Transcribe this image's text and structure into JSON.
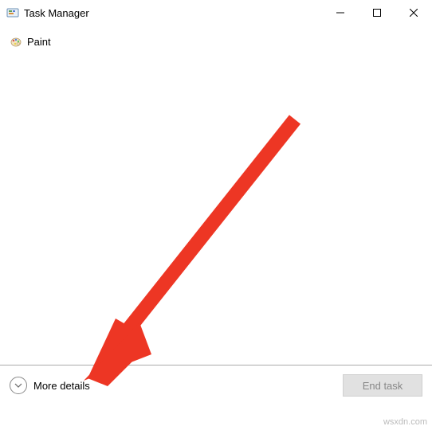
{
  "window": {
    "title": "Task Manager"
  },
  "processes": [
    {
      "name": "Paint",
      "icon": "paint-icon"
    }
  ],
  "footer": {
    "more_details_label": "More details",
    "end_task_label": "End task"
  },
  "annotation": {
    "arrow_color": "#ed3624",
    "arrow_target": "more-details-button"
  },
  "watermark": "wsxdn.com"
}
